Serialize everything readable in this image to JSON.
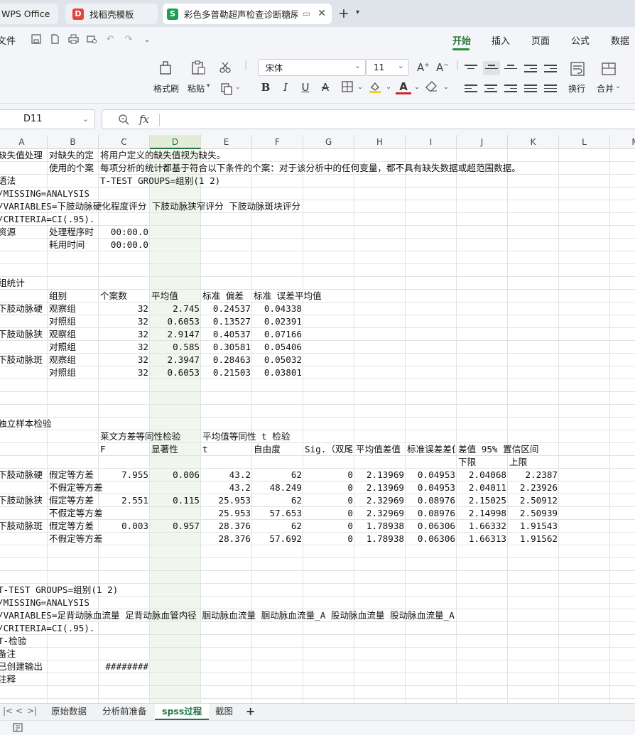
{
  "window_tabs": [
    {
      "label": "WPS Office",
      "icon": "wps-logo-icon"
    },
    {
      "label": "找稻壳模板",
      "icon": "docer-icon"
    },
    {
      "label": "彩色多普勒超声检查诊断糖尿病",
      "icon": "spreadsheet-icon"
    }
  ],
  "menu": {
    "file": "文件",
    "items": [
      "开始",
      "插入",
      "页面",
      "公式",
      "数据"
    ],
    "active": "开始"
  },
  "ribbon": {
    "format_painter": "格式刷",
    "paste": "粘贴",
    "font_name": "宋体",
    "font_size": "11",
    "wrap": "换行",
    "merge": "合并"
  },
  "formula_bar": {
    "cell_ref": "D11",
    "fx": "fx",
    "content": ""
  },
  "columns": [
    "A",
    "B",
    "C",
    "D",
    "E",
    "F",
    "G",
    "H",
    "I",
    "J",
    "K",
    "L",
    "M"
  ],
  "selected_column": "D",
  "rows": [
    [
      {
        "c": 0,
        "t": "缺失值处理"
      },
      {
        "c": 1,
        "t": "对缺失的定"
      },
      {
        "c": 2,
        "t": "将用户定义的缺失值视为缺失。"
      }
    ],
    [
      {
        "c": 1,
        "t": "使用的个案"
      },
      {
        "c": 2,
        "t": "每项分析的统计都基于符合以下条件的个案：对于该分析中的任何变量，都不具有缺失数据或超范围数据。"
      }
    ],
    [
      {
        "c": 0,
        "t": "语法"
      },
      {
        "c": 2,
        "t": "T-TEST GROUPS=组别(1 2)"
      }
    ],
    [
      {
        "c": 0,
        "t": "  /MISSING=ANALYSIS"
      }
    ],
    [
      {
        "c": 0,
        "t": "  /VARIABLES=下肢动脉硬化程度评分 下肢动脉狭窄评分 下肢动脉斑块评分"
      }
    ],
    [
      {
        "c": 0,
        "t": "  /CRITERIA=CI(.95)."
      }
    ],
    [
      {
        "c": 0,
        "t": "资源"
      },
      {
        "c": 1,
        "t": "处理程序时"
      },
      {
        "c": 2,
        "t": "00:00.0",
        "a": "r"
      }
    ],
    [
      {
        "c": 1,
        "t": "耗用时间"
      },
      {
        "c": 2,
        "t": "00:00.0",
        "a": "r"
      }
    ],
    [],
    [],
    [
      {
        "c": 0,
        "t": "组统计"
      }
    ],
    [
      {
        "c": 1,
        "t": "组别"
      },
      {
        "c": 2,
        "t": "个案数"
      },
      {
        "c": 3,
        "t": "平均值"
      },
      {
        "c": 4,
        "t": "标准 偏差"
      },
      {
        "c": 5,
        "t": "标准 误差平均值"
      }
    ],
    [
      {
        "c": 0,
        "t": "下肢动脉硬"
      },
      {
        "c": 1,
        "t": "观察组"
      },
      {
        "c": 2,
        "t": "32",
        "a": "r"
      },
      {
        "c": 3,
        "t": "2.745",
        "a": "r"
      },
      {
        "c": 4,
        "t": "0.24537",
        "a": "r"
      },
      {
        "c": 5,
        "t": "0.04338",
        "a": "r"
      }
    ],
    [
      {
        "c": 1,
        "t": "对照组"
      },
      {
        "c": 2,
        "t": "32",
        "a": "r"
      },
      {
        "c": 3,
        "t": "0.6053",
        "a": "r"
      },
      {
        "c": 4,
        "t": "0.13527",
        "a": "r"
      },
      {
        "c": 5,
        "t": "0.02391",
        "a": "r"
      }
    ],
    [
      {
        "c": 0,
        "t": "下肢动脉狭"
      },
      {
        "c": 1,
        "t": "观察组"
      },
      {
        "c": 2,
        "t": "32",
        "a": "r"
      },
      {
        "c": 3,
        "t": "2.9147",
        "a": "r"
      },
      {
        "c": 4,
        "t": "0.40537",
        "a": "r"
      },
      {
        "c": 5,
        "t": "0.07166",
        "a": "r"
      }
    ],
    [
      {
        "c": 1,
        "t": "对照组"
      },
      {
        "c": 2,
        "t": "32",
        "a": "r"
      },
      {
        "c": 3,
        "t": "0.585",
        "a": "r"
      },
      {
        "c": 4,
        "t": "0.30581",
        "a": "r"
      },
      {
        "c": 5,
        "t": "0.05406",
        "a": "r"
      }
    ],
    [
      {
        "c": 0,
        "t": "下肢动脉斑"
      },
      {
        "c": 1,
        "t": "观察组"
      },
      {
        "c": 2,
        "t": "32",
        "a": "r"
      },
      {
        "c": 3,
        "t": "2.3947",
        "a": "r"
      },
      {
        "c": 4,
        "t": "0.28463",
        "a": "r"
      },
      {
        "c": 5,
        "t": "0.05032",
        "a": "r"
      }
    ],
    [
      {
        "c": 1,
        "t": "对照组"
      },
      {
        "c": 2,
        "t": "32",
        "a": "r"
      },
      {
        "c": 3,
        "t": "0.6053",
        "a": "r"
      },
      {
        "c": 4,
        "t": "0.21503",
        "a": "r"
      },
      {
        "c": 5,
        "t": "0.03801",
        "a": "r"
      }
    ],
    [],
    [],
    [],
    [
      {
        "c": 0,
        "t": "独立样本检验"
      }
    ],
    [
      {
        "c": 2,
        "t": "莱文方差等同性检验"
      },
      {
        "c": 4,
        "t": "平均值等同性 t 检验"
      }
    ],
    [
      {
        "c": 2,
        "t": "F"
      },
      {
        "c": 3,
        "t": "显著性"
      },
      {
        "c": 4,
        "t": "t"
      },
      {
        "c": 5,
        "t": "自由度"
      },
      {
        "c": 6,
        "t": "Sig.（双尾）",
        "clip": true
      },
      {
        "c": 7,
        "t": "平均值差值",
        "clip": true
      },
      {
        "c": 8,
        "t": "标准误差差值",
        "clip": true
      },
      {
        "c": 9,
        "t": "差值 95% 置信区间"
      }
    ],
    [
      {
        "c": 9,
        "t": "下限"
      },
      {
        "c": 10,
        "t": "上限"
      }
    ],
    [
      {
        "c": 0,
        "t": "下肢动脉硬"
      },
      {
        "c": 1,
        "t": "假定等方差",
        "clip": true
      },
      {
        "c": 2,
        "t": "7.955",
        "a": "r"
      },
      {
        "c": 3,
        "t": "0.006",
        "a": "r"
      },
      {
        "c": 4,
        "t": "43.2",
        "a": "r"
      },
      {
        "c": 5,
        "t": "62",
        "a": "r"
      },
      {
        "c": 6,
        "t": "0",
        "a": "r"
      },
      {
        "c": 7,
        "t": "2.13969",
        "a": "r"
      },
      {
        "c": 8,
        "t": "0.04953",
        "a": "r"
      },
      {
        "c": 9,
        "t": "2.04068",
        "a": "r"
      },
      {
        "c": 10,
        "t": "2.2387",
        "a": "r"
      }
    ],
    [
      {
        "c": 1,
        "t": "不假定等方差"
      },
      {
        "c": 4,
        "t": "43.2",
        "a": "r"
      },
      {
        "c": 5,
        "t": "48.249",
        "a": "r"
      },
      {
        "c": 6,
        "t": "0",
        "a": "r"
      },
      {
        "c": 7,
        "t": "2.13969",
        "a": "r"
      },
      {
        "c": 8,
        "t": "0.04953",
        "a": "r"
      },
      {
        "c": 9,
        "t": "2.04011",
        "a": "r"
      },
      {
        "c": 10,
        "t": "2.23926",
        "a": "r"
      }
    ],
    [
      {
        "c": 0,
        "t": "下肢动脉狭"
      },
      {
        "c": 1,
        "t": "假定等方差",
        "clip": true
      },
      {
        "c": 2,
        "t": "2.551",
        "a": "r"
      },
      {
        "c": 3,
        "t": "0.115",
        "a": "r"
      },
      {
        "c": 4,
        "t": "25.953",
        "a": "r"
      },
      {
        "c": 5,
        "t": "62",
        "a": "r"
      },
      {
        "c": 6,
        "t": "0",
        "a": "r"
      },
      {
        "c": 7,
        "t": "2.32969",
        "a": "r"
      },
      {
        "c": 8,
        "t": "0.08976",
        "a": "r"
      },
      {
        "c": 9,
        "t": "2.15025",
        "a": "r"
      },
      {
        "c": 10,
        "t": "2.50912",
        "a": "r"
      }
    ],
    [
      {
        "c": 1,
        "t": "不假定等方差"
      },
      {
        "c": 4,
        "t": "25.953",
        "a": "r"
      },
      {
        "c": 5,
        "t": "57.653",
        "a": "r"
      },
      {
        "c": 6,
        "t": "0",
        "a": "r"
      },
      {
        "c": 7,
        "t": "2.32969",
        "a": "r"
      },
      {
        "c": 8,
        "t": "0.08976",
        "a": "r"
      },
      {
        "c": 9,
        "t": "2.14998",
        "a": "r"
      },
      {
        "c": 10,
        "t": "2.50939",
        "a": "r"
      }
    ],
    [
      {
        "c": 0,
        "t": "下肢动脉斑"
      },
      {
        "c": 1,
        "t": "假定等方差",
        "clip": true
      },
      {
        "c": 2,
        "t": "0.003",
        "a": "r"
      },
      {
        "c": 3,
        "t": "0.957",
        "a": "r"
      },
      {
        "c": 4,
        "t": "28.376",
        "a": "r"
      },
      {
        "c": 5,
        "t": "62",
        "a": "r"
      },
      {
        "c": 6,
        "t": "0",
        "a": "r"
      },
      {
        "c": 7,
        "t": "1.78938",
        "a": "r"
      },
      {
        "c": 8,
        "t": "0.06306",
        "a": "r"
      },
      {
        "c": 9,
        "t": "1.66332",
        "a": "r"
      },
      {
        "c": 10,
        "t": "1.91543",
        "a": "r"
      }
    ],
    [
      {
        "c": 1,
        "t": "不假定等方差"
      },
      {
        "c": 4,
        "t": "28.376",
        "a": "r"
      },
      {
        "c": 5,
        "t": "57.692",
        "a": "r"
      },
      {
        "c": 6,
        "t": "0",
        "a": "r"
      },
      {
        "c": 7,
        "t": "1.78938",
        "a": "r"
      },
      {
        "c": 8,
        "t": "0.06306",
        "a": "r"
      },
      {
        "c": 9,
        "t": "1.66313",
        "a": "r"
      },
      {
        "c": 10,
        "t": "1.91562",
        "a": "r"
      }
    ],
    [],
    [],
    [],
    [
      {
        "c": 0,
        "t": "T-TEST GROUPS=组别(1 2)"
      }
    ],
    [
      {
        "c": 0,
        "t": "  /MISSING=ANALYSIS"
      }
    ],
    [
      {
        "c": 0,
        "t": "  /VARIABLES=足背动脉血流量 足背动脉血管内径 腘动脉血流量 腘动脉血流量_A 股动脉血流量 股动脉血流量_A"
      }
    ],
    [
      {
        "c": 0,
        "t": "  /CRITERIA=CI(.95)."
      }
    ],
    [
      {
        "c": 0,
        "t": "T-检验"
      }
    ],
    [
      {
        "c": 0,
        "t": "备注"
      }
    ],
    [
      {
        "c": 0,
        "t": "已创建输出"
      },
      {
        "c": 2,
        "t": "########",
        "a": "r"
      }
    ],
    [
      {
        "c": 0,
        "t": "注释"
      }
    ]
  ],
  "sheet_tabs": [
    "原始数据",
    "分析前准备",
    "spss过程",
    "截图"
  ],
  "active_sheet": "spss过程",
  "colors": {
    "accent": "#217346",
    "tab_active_green": "#2a8a3a"
  }
}
